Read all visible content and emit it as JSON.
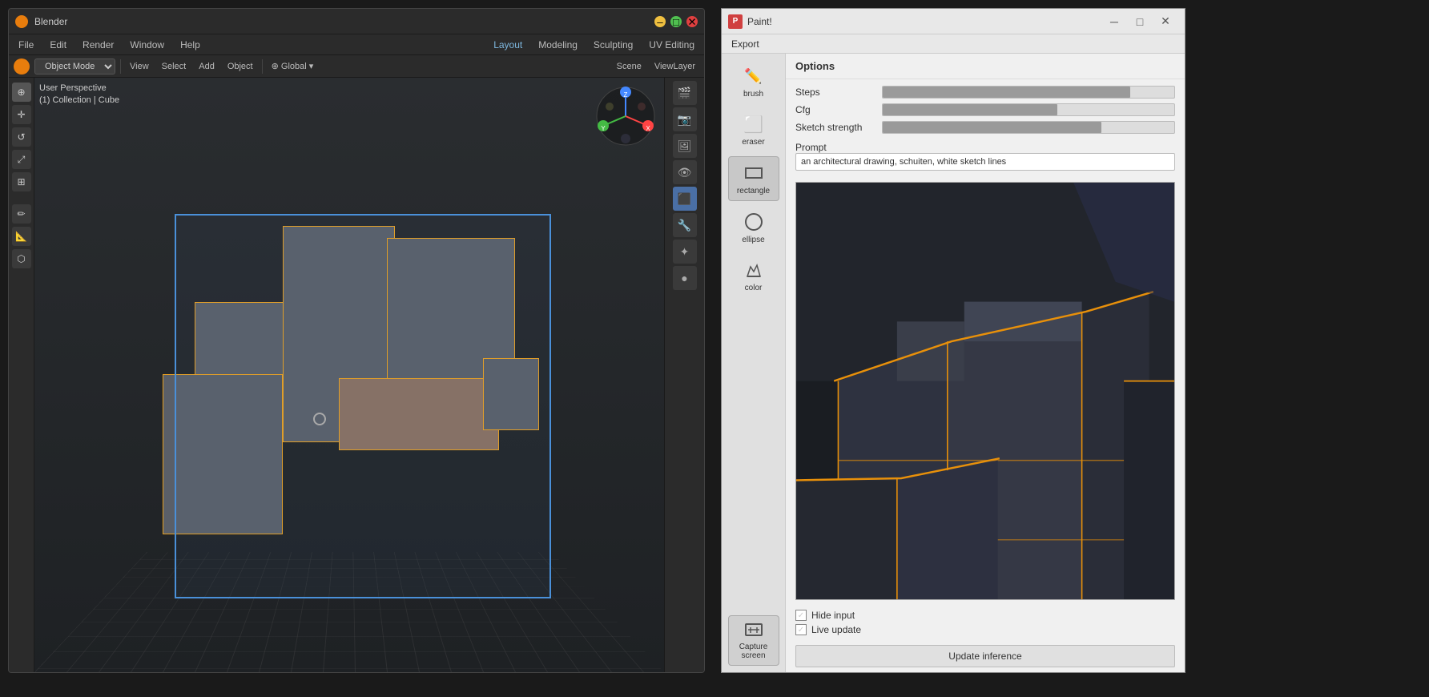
{
  "blender": {
    "title": "Blender",
    "menu": [
      "File",
      "Edit",
      "Render",
      "Window",
      "Help"
    ],
    "workspace_tabs": [
      "Layout",
      "Modeling",
      "Sculpting",
      "UV Editing"
    ],
    "active_tab": "Layout",
    "toolbar": {
      "mode": "Object Mode",
      "items": [
        "View",
        "Select",
        "Add",
        "Object",
        "Global"
      ]
    },
    "viewport_label_top": "User Perspective",
    "viewport_label_bottom": "(1) Collection | Cube",
    "left_tools": [
      "cursor",
      "move",
      "rotate",
      "scale",
      "transform",
      "annotate",
      "measure",
      "cage"
    ],
    "scene": "Collection | Cube"
  },
  "paint": {
    "title": "Paint!",
    "menu": [
      "Export"
    ],
    "options_header": "Options",
    "options": {
      "steps_label": "Steps",
      "cfg_label": "Cfg",
      "sketch_strength_label": "Sketch strength",
      "prompt_label": "Prompt",
      "prompt_value": "an architectural drawing, schuiten, white sketch lines"
    },
    "sliders": {
      "steps_pct": 85,
      "cfg_pct": 60,
      "sketch_strength_pct": 75
    },
    "tools": [
      {
        "id": "brush",
        "label": "brush",
        "icon": "✏️"
      },
      {
        "id": "eraser",
        "label": "eraser",
        "icon": "⬜"
      },
      {
        "id": "rectangle",
        "label": "rectangle",
        "icon": "▭"
      },
      {
        "id": "ellipse",
        "label": "ellipse",
        "icon": "⭕"
      },
      {
        "id": "color",
        "label": "color",
        "icon": "🎨"
      }
    ],
    "capture_btn": "Capture screen",
    "checkboxes": [
      {
        "id": "hide_input",
        "label": "Hide input",
        "checked": true
      },
      {
        "id": "live_update",
        "label": "Live update",
        "checked": true
      }
    ],
    "update_btn": "Update inference"
  }
}
